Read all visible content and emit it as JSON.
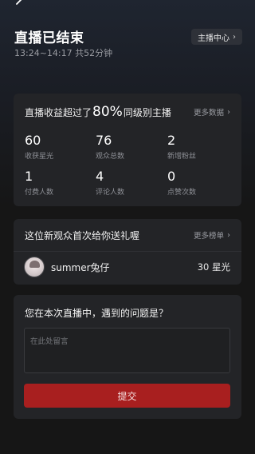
{
  "header": {
    "title": "直播已结束",
    "subtitle": "13:24~14:17 共52分钟",
    "host_center_label": "主播中心",
    "chevron": "›"
  },
  "stats": {
    "heading_prefix": "直播收益超过了",
    "heading_percent": "80%",
    "heading_suffix": "同级别主播",
    "more_label": "更多数据",
    "items": [
      {
        "value": "60",
        "label": "收获星光"
      },
      {
        "value": "76",
        "label": "观众总数"
      },
      {
        "value": "2",
        "label": "新增粉丝"
      },
      {
        "value": "1",
        "label": "付费人数"
      },
      {
        "value": "4",
        "label": "评论人数"
      },
      {
        "value": "0",
        "label": "点赞次数"
      }
    ]
  },
  "gift": {
    "heading": "这位新观众首次给你送礼喔",
    "more_label": "更多榜单",
    "user_name": "summer兔仔",
    "amount": "30 星光"
  },
  "feedback": {
    "question": "您在本次直播中，遇到的问题是？",
    "placeholder": "在此处留言",
    "value": "",
    "submit_label": "提交"
  },
  "colors": {
    "background": "#161616",
    "card": "#232427",
    "accent_red": "#a81f1f",
    "muted_text": "#9a9ca2"
  },
  "icons": {
    "back": "back-arrow-icon",
    "chevron": "chevron-right-icon",
    "avatar": "user-avatar"
  }
}
